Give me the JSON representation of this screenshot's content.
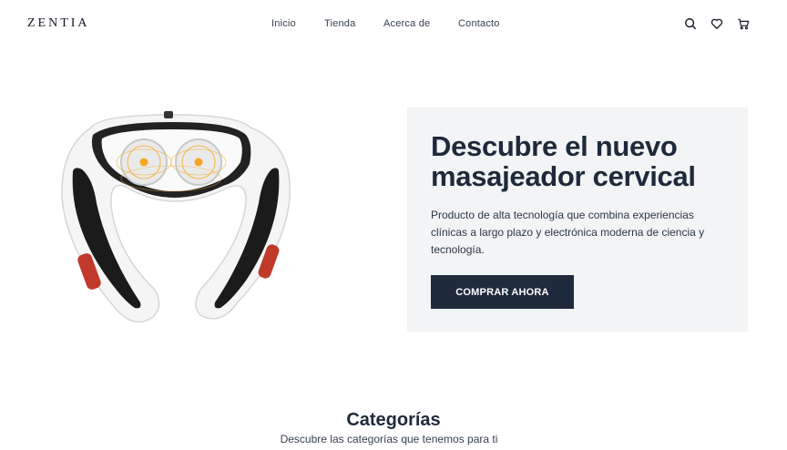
{
  "header": {
    "logo": "ZENTIA",
    "nav": [
      "Inicio",
      "Tienda",
      "Acerca de",
      "Contacto"
    ],
    "icons": [
      "search-icon",
      "heart-icon",
      "cart-icon"
    ]
  },
  "hero": {
    "title": "Descubre el nuevo masajeador cervical",
    "description": "Producto de alta tecnología que combina experiencias clínicas a largo plazo y electrónica moderna de ciencia y tecnología.",
    "cta_label": "COMPRAR AHORA"
  },
  "categories": {
    "title": "Categorías",
    "subtitle": "Descubre las categorías que tenemos para ti"
  },
  "colors": {
    "accent": "#1f2a3d",
    "card_bg": "#f2f4f6",
    "pad_accent": "#f5a623"
  }
}
